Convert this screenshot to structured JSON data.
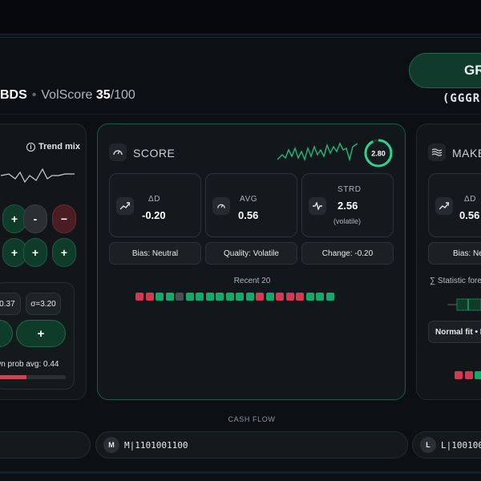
{
  "header": {
    "pill_label": "GR",
    "ticker_sub": "(GGGR",
    "headline_code": "BDS",
    "headline_sep": "•",
    "volscore_label": "VolScore",
    "volscore_value": "35",
    "volscore_max": "/100"
  },
  "left_card": {
    "trend_label": "Trend mix",
    "buttons_row1": [
      "+",
      "-",
      "−"
    ],
    "buttons_row2": [
      "+",
      "+",
      "+"
    ],
    "mu_chip": "=0.37",
    "sigma_chip": "σ=3.20",
    "big_button_label": "+",
    "prob_text": "wn prob avg: 0.44",
    "prob_fraction": 0.44
  },
  "score_card": {
    "title": "SCORE",
    "score_value": "2.80",
    "score_fraction": 0.93,
    "stats": [
      {
        "label": "ΔD",
        "value": "-0.20",
        "sub": ""
      },
      {
        "label": "AVG",
        "value": "0.56",
        "sub": ""
      },
      {
        "label": "STRD",
        "value": "2.56",
        "sub": "(volatile)"
      }
    ],
    "info": [
      "Bias: Neutral",
      "Quality: Volatile",
      "Change: -0.20"
    ],
    "recent_label": "Recent 20",
    "recent": [
      "r",
      "r",
      "g",
      "g",
      "n",
      "g",
      "g",
      "g",
      "g",
      "g",
      "g",
      "g",
      "r",
      "g",
      "r",
      "r",
      "r",
      "g",
      "g",
      "g"
    ],
    "colors": {
      "r": "#d13a53",
      "g": "#14a86a",
      "n": "#4a4f54"
    }
  },
  "make_card": {
    "title": "MAKE",
    "stat_label": "ΔD",
    "stat_value": "0.56",
    "info": "Bias: Ne",
    "statistic_text": "∑ Statistic fore",
    "normal_fit": "Normal fit • P(",
    "recent": [
      "r",
      "r",
      "g"
    ]
  },
  "cash_flow": {
    "label": "CASH FLOW",
    "items": [
      {
        "badge": "M",
        "code": "M|1101001100"
      },
      {
        "badge": "L",
        "code": "L|1001001"
      }
    ]
  },
  "colors": {
    "accent": "#1f8a5e",
    "down": "#d13a53",
    "up": "#14a86a"
  }
}
